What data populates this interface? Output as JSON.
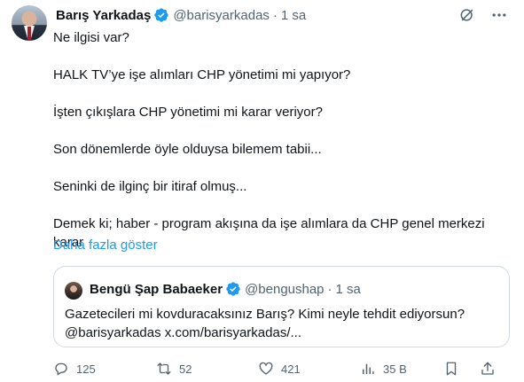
{
  "tweet": {
    "author_name": "Barış Yarkadaş",
    "handle": "@barisyarkadas",
    "separator": "·",
    "time": "1 sa",
    "lines": [
      "Ne ilgisi var?",
      "HALK TV’ye işe alımları CHP yönetimi mi yapıyor?",
      "İşten çıkışlara CHP yönetimi mi karar veriyor?",
      "Son dönemlerde öyle olduysa bilemem tabii...",
      "Seninki  de ilginç bir itiraf olmuş...",
      "Demek ki; haber - program akışına da işe alımlara da CHP genel merkezi",
      "karar"
    ],
    "show_more": "Daha fazla göster"
  },
  "quoted": {
    "author_name": "Bengü Şap Babaeker",
    "handle": "@bengushap",
    "separator": "·",
    "time": "1 sa",
    "lines": [
      "Gazetecileri mi kovduracaksınız Barış? Kimi  neyle tehdit ediyorsun?",
      "@barisyarkadas x.com/barisyarkadas/..."
    ]
  },
  "actions": {
    "replies": "125",
    "reposts": "52",
    "likes": "421",
    "views": "35 B"
  },
  "icons": {
    "verified": "verified-badge-icon",
    "grok": "grok-icon",
    "more": "more-icon",
    "reply": "reply-icon",
    "repost": "repost-icon",
    "like": "like-icon",
    "views": "views-icon",
    "bookmark": "bookmark-icon",
    "share": "share-icon"
  },
  "colors": {
    "text": "#0f1419",
    "secondary": "#536471",
    "link": "#1d9bf0",
    "verified": "#1d9bf0",
    "border": "#cfd9de"
  }
}
